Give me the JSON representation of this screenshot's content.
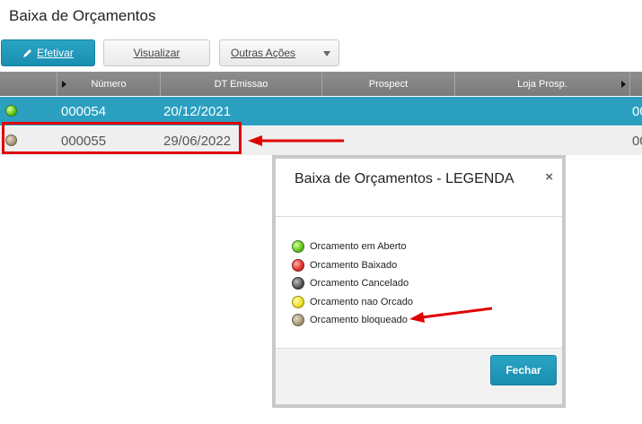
{
  "page": {
    "title": "Baixa de Orçamentos"
  },
  "toolbar": {
    "efetivar_label": "Efetivar",
    "visualizar_label": "Visualizar",
    "outras_label": "Outras Ações"
  },
  "grid": {
    "columns": [
      "",
      "Número",
      "DT Emissao",
      "Prospect",
      "Loja Prosp."
    ],
    "rows": [
      {
        "status": "green",
        "numero": "000054",
        "data": "20/12/2021",
        "trunc": "00"
      },
      {
        "status": "tan",
        "numero": "000055",
        "data": "29/06/2022",
        "trunc": "00"
      }
    ]
  },
  "dialog": {
    "title": "Baixa de Orçamentos - LEGENDA",
    "close": "×",
    "legend": [
      {
        "color": "green",
        "label": "Orcamento em Aberto"
      },
      {
        "color": "red",
        "label": "Orcamento Baixado"
      },
      {
        "color": "dark-gray",
        "label": "Orcamento Cancelado"
      },
      {
        "color": "yellow",
        "label": "Orcamento nao Orcado"
      },
      {
        "color": "tan",
        "label": "Orcamento bloqueado"
      }
    ],
    "fechar_label": "Fechar"
  },
  "colors": {
    "accent": "#2b9fc0",
    "header_gray": "#858585",
    "annotation_red": "#e00000"
  }
}
